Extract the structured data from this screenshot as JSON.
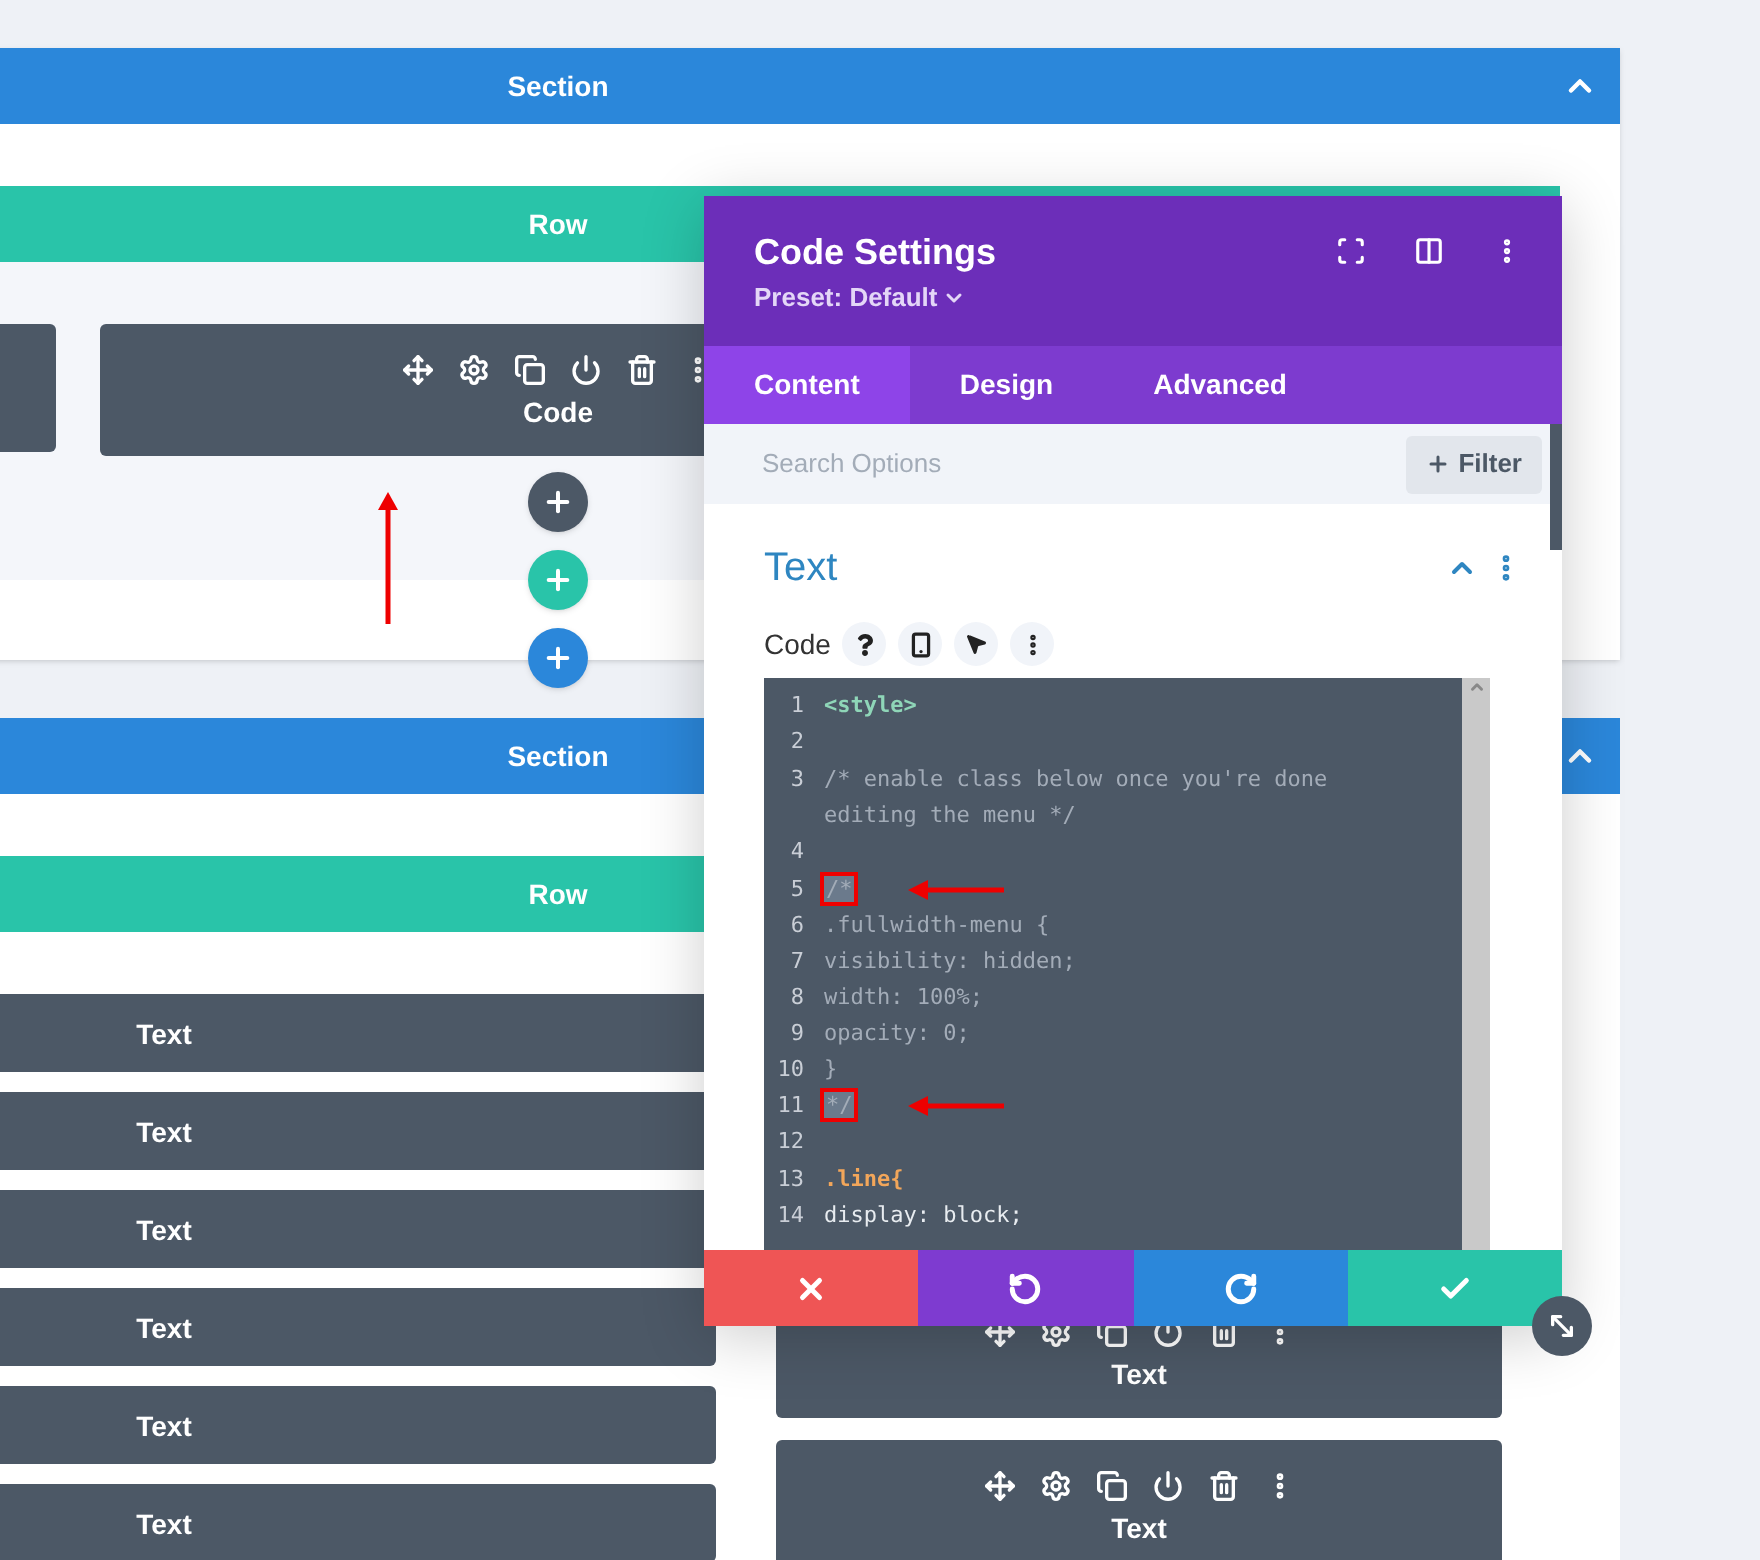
{
  "sections": [
    {
      "label": "Section",
      "expanded": true,
      "row": {
        "label": "Row",
        "columns": [
          {
            "modules": [
              {
                "kind": "blank"
              }
            ]
          },
          {
            "modules": [
              {
                "kind": "module",
                "label": "Code",
                "hovered": true
              }
            ]
          }
        ]
      }
    },
    {
      "label": "Section",
      "expanded": true,
      "row": {
        "label": "Row",
        "columns": [
          {
            "modules": [
              {
                "kind": "module",
                "label": "Text",
                "hovered": false
              },
              {
                "kind": "module",
                "label": "Text",
                "hovered": false
              },
              {
                "kind": "module",
                "label": "Text",
                "hovered": false
              },
              {
                "kind": "module",
                "label": "Text",
                "hovered": false
              },
              {
                "kind": "module",
                "label": "Text",
                "hovered": false
              },
              {
                "kind": "module",
                "label": "Text",
                "hovered": false
              }
            ]
          },
          {
            "modules": [
              {
                "kind": "module",
                "label": "Text",
                "hovered": true
              },
              {
                "kind": "module",
                "label": "Text",
                "hovered": true
              }
            ]
          }
        ]
      }
    }
  ],
  "modal": {
    "title": "Code Settings",
    "preset": "Preset: Default",
    "tabs": [
      {
        "label": "Content",
        "selected": true
      },
      {
        "label": "Design",
        "selected": false
      },
      {
        "label": "Advanced",
        "selected": false
      }
    ],
    "search": {
      "placeholder": "Search Options"
    },
    "filter_button": "Filter",
    "group": {
      "title": "Text",
      "expanded": true
    },
    "field_label": "Code",
    "code_lines": [
      {
        "number": "1",
        "text": "<style>",
        "kind": "tag",
        "marked": false
      },
      {
        "number": "2",
        "kind": "code",
        "marked": false
      },
      {
        "number": "3",
        "text": "/* enable class below once you're done editing the menu */",
        "kind": "comment",
        "marked": false
      },
      {
        "number": "4",
        "kind": "code",
        "marked": false
      },
      {
        "number": "5",
        "text": "/*",
        "kind": "comment",
        "marked": true
      },
      {
        "number": "6",
        "text": ".fullwidth-menu {",
        "kind": "comment",
        "marked": false
      },
      {
        "number": "7",
        "text": "visibility: hidden;",
        "kind": "comment",
        "marked": false
      },
      {
        "number": "8",
        "text": "width: 100%;",
        "kind": "comment",
        "marked": false
      },
      {
        "number": "9",
        "text": "opacity: 0;",
        "kind": "comment",
        "marked": false
      },
      {
        "number": "10",
        "text": "}",
        "kind": "comment",
        "marked": false
      },
      {
        "number": "11",
        "text": "*/",
        "kind": "comment",
        "marked": true
      },
      {
        "number": "12",
        "kind": "code",
        "marked": false
      },
      {
        "number": "13",
        "text": ".line{",
        "kind": "selector",
        "marked": false
      },
      {
        "number": "14",
        "text": "display: block;",
        "kind": "code",
        "marked": false
      }
    ],
    "footer_buttons": [
      {
        "kind": "cancel"
      },
      {
        "kind": "undo"
      },
      {
        "kind": "redo"
      },
      {
        "kind": "save"
      }
    ]
  }
}
